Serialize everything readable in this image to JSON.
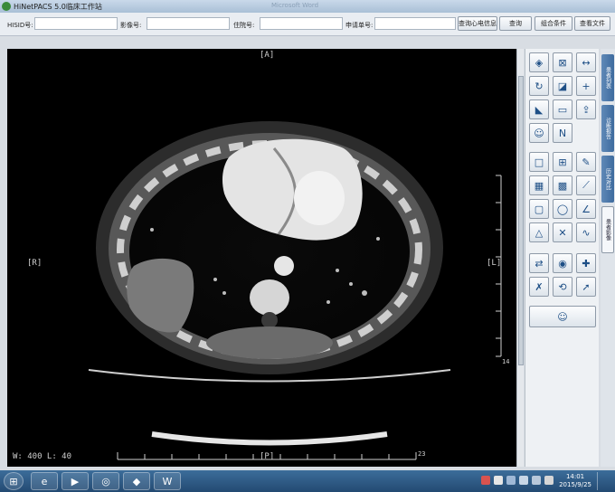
{
  "window": {
    "title": "HiNetPACS 5.0临床工作站",
    "ghost_title": "Microsoft Word"
  },
  "search": {
    "hisid_label": "HISID号:",
    "image_no_label": "影像号:",
    "inpatient_label": "住院号:",
    "request_label": "申请单号:",
    "ecg_button": "查询心电信息",
    "query_button": "查询",
    "combo_button": "组合条件",
    "report_button": "查看文件"
  },
  "viewer": {
    "marker_top": "[A]",
    "marker_bottom": "[P]",
    "marker_left": "[R]",
    "marker_right": "[L]",
    "window_level": "W: 400  L: 40",
    "scale_num_right": "14",
    "scale_num_bottom": "23"
  },
  "side_tabs": [
    "患者列表",
    "诊断报告",
    "历史对比",
    "患者影像"
  ],
  "tools": [
    "window-level-icon",
    "ratio-icon",
    "horizontal-fit-icon",
    "rotate-icon",
    "invert-icon",
    "zoom-in-icon",
    "triangle-icon",
    "level-icon",
    "export-icon",
    "head-icon",
    "north-icon",
    "layout-1x1-icon",
    "layout-2x2-icon",
    "pen-icon",
    "layout-2x2-grid-icon",
    "layout-3x3-icon",
    "line-measure-icon",
    "rect-roi-icon",
    "ellipse-roi-icon",
    "angle-icon",
    "triangle-measure-icon",
    "cross-measure-icon",
    "freehand-icon",
    "series-sync-icon",
    "mpr-icon",
    "localize-icon",
    "delete-annotation-icon",
    "reset-icon",
    "arrow-icon",
    "big-head-icon"
  ],
  "taskbar": {
    "time": "14:01",
    "date": "2015/9/25"
  }
}
